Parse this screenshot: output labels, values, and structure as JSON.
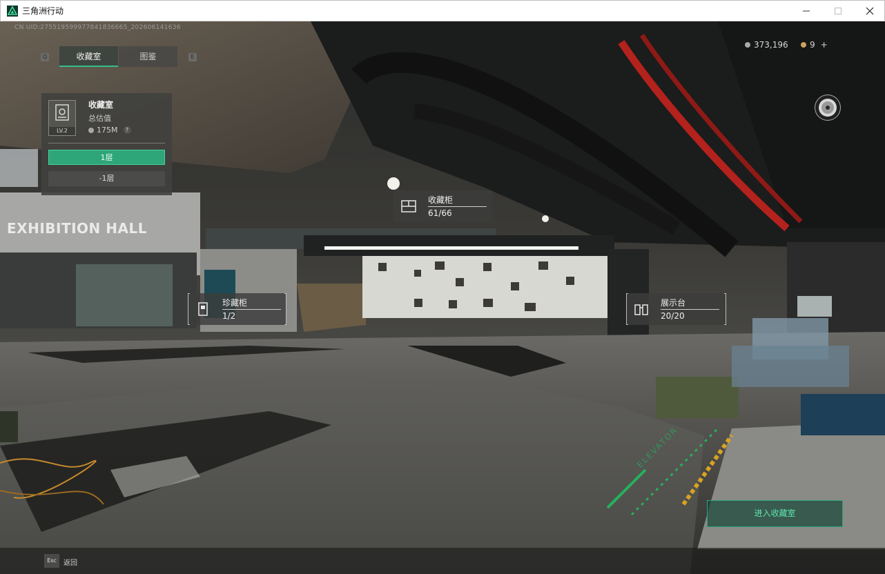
{
  "window": {
    "title": "三角洲行动",
    "min_glyph": "—",
    "max_glyph": "☐",
    "close_glyph": "✕"
  },
  "uid_text": "CN UID:275519599977841836665_202606141636",
  "tabs": {
    "prev_key": "Q",
    "next_key": "E",
    "items": [
      {
        "label": "收藏室",
        "active": true
      },
      {
        "label": "图鉴",
        "active": false
      }
    ]
  },
  "currency": {
    "coins": "373,196",
    "tickets": "9",
    "add": "+"
  },
  "panel": {
    "title": "收藏室",
    "level": "LV.2",
    "subtitle": "总估值",
    "value": "175M",
    "help": "?",
    "floors": [
      {
        "label": "1层",
        "active": true
      },
      {
        "label": "-1层",
        "active": false
      }
    ]
  },
  "callouts": {
    "cabinet": {
      "title": "收藏柜",
      "count": "61/66"
    },
    "rare": {
      "title": "珍藏柜",
      "count": "1/2"
    },
    "display": {
      "title": "展示台",
      "count": "20/20"
    }
  },
  "scene_text": {
    "hall_sign": "EXHIBITION HALL",
    "floor_sign": "ELEVATOR"
  },
  "enter_button": "进入收藏室",
  "bottom": {
    "esc_key": "Esc",
    "esc_label": "返回"
  },
  "colors": {
    "accent": "#33c08a",
    "pipe_red": "#b3221c"
  }
}
